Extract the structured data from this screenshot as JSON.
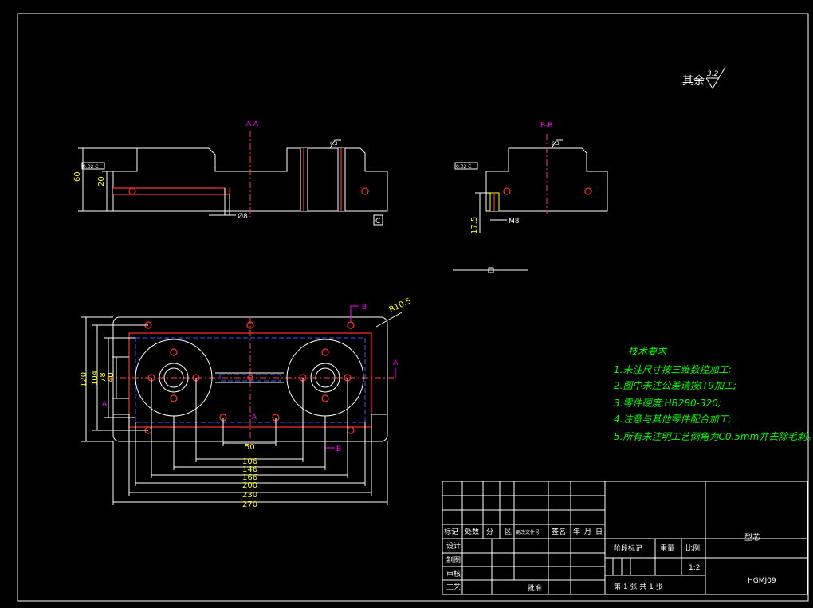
{
  "top_note": {
    "label": "其余",
    "roughness": "3.2"
  },
  "section_a": {
    "title": "A-A",
    "dims": [
      "60",
      "20",
      "Ø8"
    ],
    "datum": "C",
    "roughness": "6.3",
    "tolerance_box": "0.02 C"
  },
  "section_b": {
    "title": "B-B",
    "dims": [
      "17.5",
      "M8"
    ],
    "roughness": "6.3",
    "tolerance_box": "0.02 C"
  },
  "plan_view": {
    "radius_label": "R10.5",
    "vertical_dims": [
      "120",
      "104",
      "78",
      "40"
    ],
    "horizontal_dims": [
      "50",
      "106",
      "146",
      "166",
      "200",
      "230",
      "270"
    ],
    "section_marks": {
      "b": "B",
      "a": "A"
    }
  },
  "tech_requirements": {
    "title": "技术要求",
    "items": [
      "1.未注尺寸按三维数控加工;",
      "2.图中未注公差请按IT9加工;",
      "3.零件硬度:HB280-320;",
      "4.注意与其他零件配合加工;",
      "5.所有未注明工艺倒角为C0.5mm并去除毛刺。"
    ]
  },
  "title_block": {
    "headers": [
      "标记",
      "处数",
      "分",
      "区",
      "更改文件号",
      "签名",
      "年",
      "月",
      "日"
    ],
    "rows": [
      "设计",
      "制图",
      "审核",
      "工艺"
    ],
    "approve": "批准",
    "stage_mark": "阶段标记",
    "weight": "重量",
    "scale_label": "比例",
    "scale": "1:2",
    "sheet_info": "第 1 张    共 1 张",
    "part_name": "型芯",
    "drawing_no": "HGMJ09"
  }
}
